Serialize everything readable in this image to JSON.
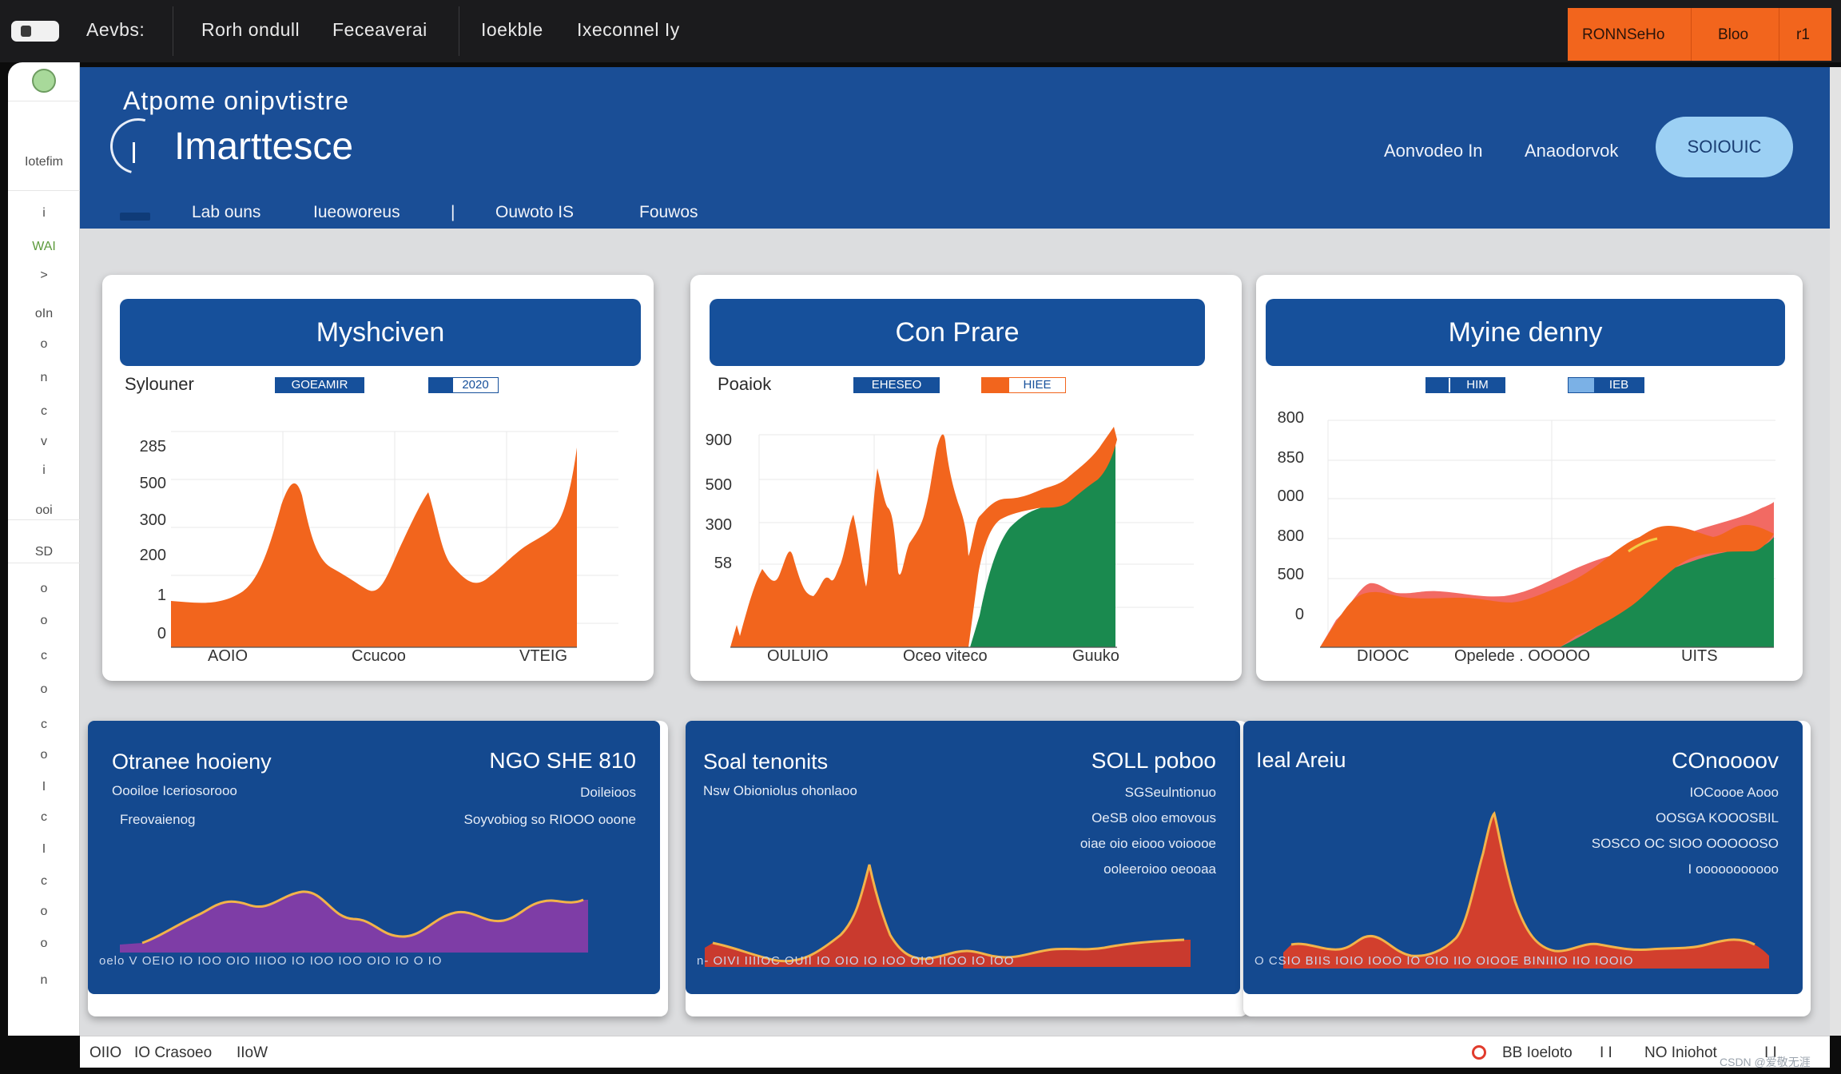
{
  "topbar": {
    "app_name": "Aevbs:",
    "menu": [
      "Rorh ondull",
      "Feceaverai",
      "Ioekble",
      "Ixeconnel Iy"
    ],
    "actions": [
      "RONNSeHo",
      "Bloo",
      "r1"
    ]
  },
  "rail": {
    "label": "Iotefim",
    "items": [
      "i",
      "WAI",
      ">",
      "oIn",
      "o",
      "n",
      "c",
      "v",
      "i",
      "ooi",
      "SD",
      "o",
      "o",
      "c",
      "o",
      "c",
      "o",
      "I",
      "c",
      "I",
      "c",
      "o",
      "o",
      "n"
    ]
  },
  "header": {
    "app_title": "Atpome onipvtistre",
    "title": "Imarttesce",
    "nav": [
      "Aonvodeo In",
      "Anaodorvok"
    ],
    "cta_label": "SOIOUIC",
    "tabs": [
      "Lab ouns",
      "Iueoworeus",
      "|",
      "Ouwoto IS",
      "Fouwos"
    ]
  },
  "cards": [
    {
      "title": "Myshciven",
      "side_label": "Sylouner",
      "legend": [
        "GOEAMIR",
        "2020"
      ],
      "x_labels": [
        "AOIO",
        "Ccucoo",
        "VTEIG"
      ],
      "y_labels": [
        "285",
        "500",
        "300",
        "200",
        "1",
        "0"
      ]
    },
    {
      "title": "Con Prare",
      "side_label": "Poaiok",
      "legend": [
        "EHESEO",
        "HIEE"
      ],
      "x_labels": [
        "OULUIO",
        "Oceo viteco",
        "Guuko"
      ],
      "y_labels": [
        "900",
        "500",
        "300",
        "58"
      ]
    },
    {
      "title": "Myine denny",
      "side_label": "",
      "legend": [
        "HIM",
        "IEB"
      ],
      "x_labels": [
        "DIOOC",
        "Opelede . OOOOO",
        "UITS"
      ],
      "y_labels": [
        "800",
        "850",
        "000",
        "800",
        "500",
        "0"
      ]
    }
  ],
  "stats": [
    {
      "title": "Otranee hooieny",
      "value": "NGO SHE 810",
      "sub_left": "Oooiloe Iceriosorooo",
      "sub_left2": "Freovaienog",
      "right_lines": [
        "Doileioos",
        "Soyvobiog so RIOOO ooone"
      ],
      "footer": "oelo V OEIO IO IOO OIO IIIOO IO IOO IOO OIO IO O IO"
    },
    {
      "title": "Soal tenonits",
      "value": "SOLL poboo",
      "sub_left": "Nsw Obioniolus ohonlaoo",
      "sub_left2": "",
      "right_lines": [
        "SGSeulntionuo",
        "OeSB oloo emovous",
        "oiae oio eiooo voioooe",
        "ooleeroioo oeooaa"
      ],
      "footer": "n- OIVI IIIIOC OUII IO OIO IO IOO OIO IIOO IO IOO"
    },
    {
      "title": "Ieal Areiu",
      "value": "COnoooov",
      "sub_left": "",
      "sub_left2": "",
      "right_lines": [
        "IOCoooe Aooo",
        "OOSGA KOOOSBIL",
        "SOSCO OC SIOO OOOOOSO",
        "I ooooooooooo"
      ],
      "footer": "O CSIO BIIS IOIO IOOO IO OIO IIO OIOOE BINIIIO IIO IOOIO"
    }
  ],
  "footer": {
    "left": [
      "OIIO",
      "IO Crasoeo",
      "IIoW"
    ],
    "right": [
      "BB Ioeloto",
      "I I",
      "NO Iniohot",
      "I I"
    ],
    "watermark": "CSDN @爱敬无涯"
  },
  "colors": {
    "header_blue": "#1a4e96",
    "orange": "#f2651d",
    "green": "#1a8a4f",
    "red": "#e84b3c",
    "purple": "#7e3da6"
  }
}
